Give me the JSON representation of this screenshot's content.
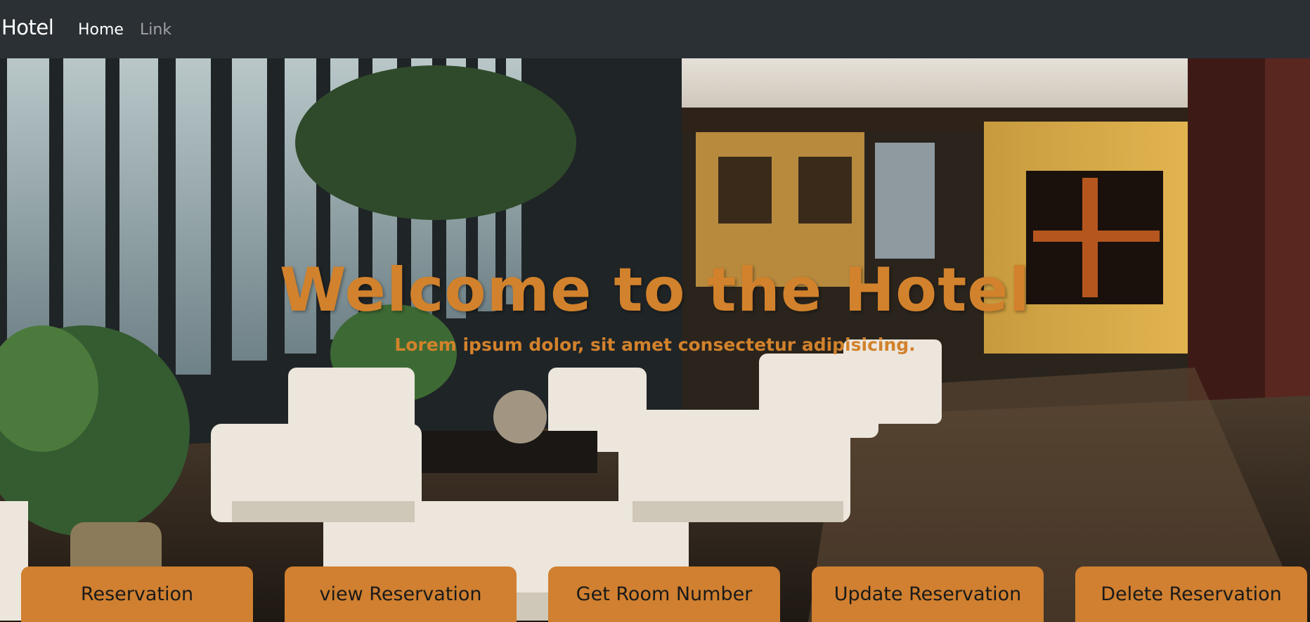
{
  "navbar": {
    "brand": "Hotel",
    "links": [
      {
        "label": "Home",
        "active": true
      },
      {
        "label": "Link",
        "active": false
      }
    ],
    "background": "#2b3035"
  },
  "hero": {
    "title": "Welcome to the Hotel",
    "subtitle": "Lorem ipsum dolor, sit amet consectetur adipisicing.",
    "accent_color": "#d2822c",
    "image_icon": "hotel-lobby-photo"
  },
  "actions": {
    "buttons": [
      {
        "label": "Reservation"
      },
      {
        "label": "view Reservation"
      },
      {
        "label": "Get Room Number"
      },
      {
        "label": "Update Reservation"
      },
      {
        "label": "Delete Reservation"
      }
    ],
    "button_color": "#d08030"
  }
}
